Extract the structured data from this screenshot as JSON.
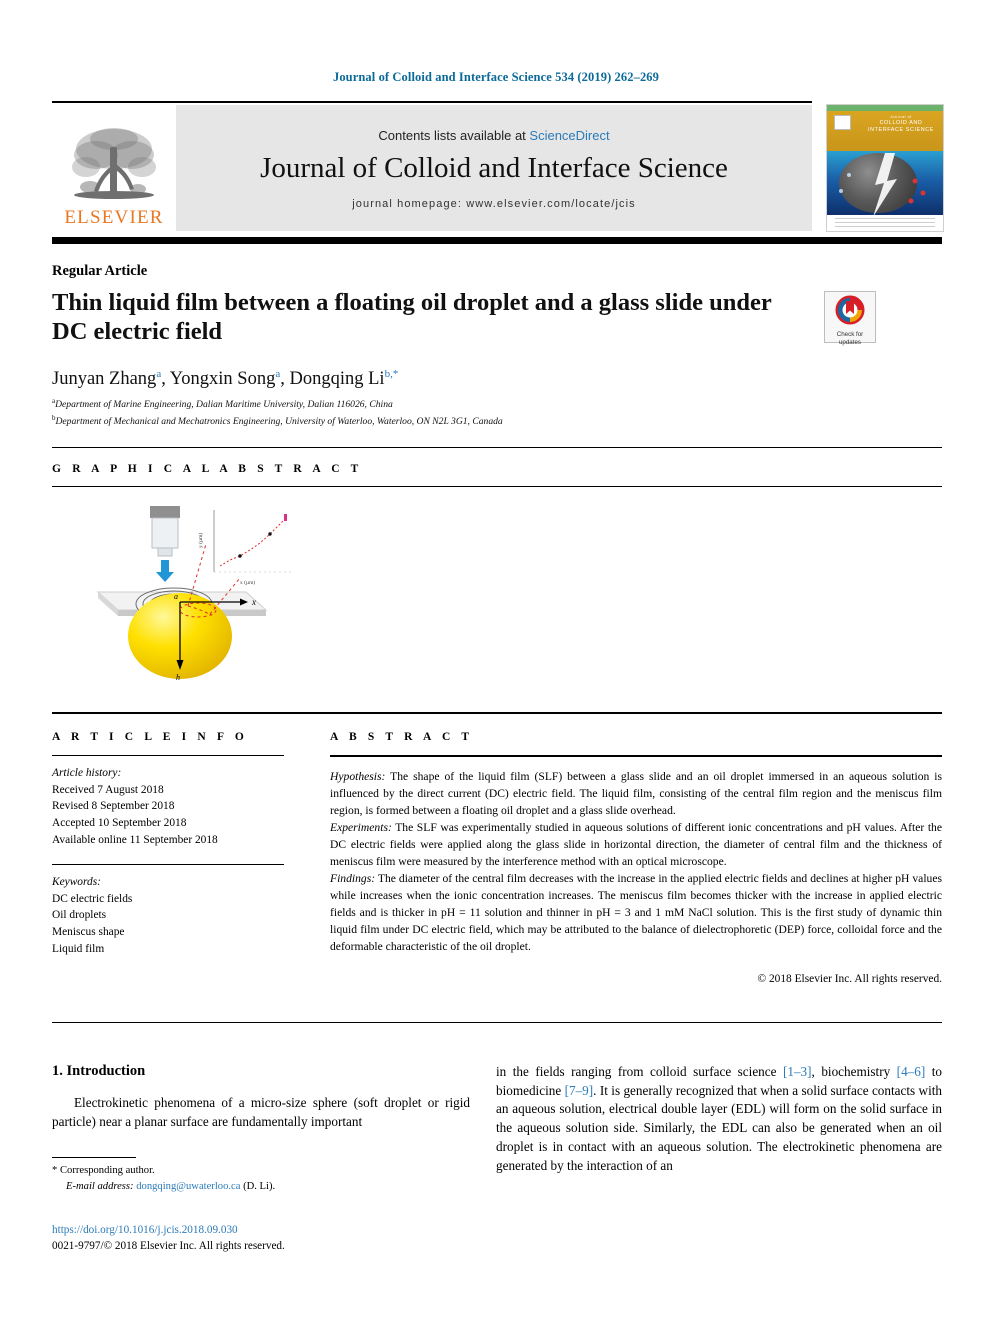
{
  "running_head": "Journal of Colloid and Interface Science 534 (2019) 262–269",
  "masthead": {
    "publisher": "ELSEVIER",
    "contents_prefix": "Contents lists available at ",
    "contents_link": "ScienceDirect",
    "journal_title": "Journal of Colloid and Interface Science",
    "homepage": "journal homepage: www.elsevier.com/locate/jcis",
    "cover_title_small": "Journal of",
    "cover_title": "COLLOID AND INTERFACE SCIENCE"
  },
  "article": {
    "type_label": "Regular Article",
    "title": "Thin liquid film between a floating oil droplet and a glass slide under DC electric field",
    "crossmark_line1": "Check for",
    "crossmark_line2": "updates",
    "authors": [
      {
        "name": "Junyan Zhang",
        "sup": "a",
        "sep": ", "
      },
      {
        "name": "Yongxin Song",
        "sup": "a",
        "sep": ", "
      },
      {
        "name": "Dongqing Li",
        "sup": "b,*",
        "sep": ""
      }
    ],
    "affiliations": [
      {
        "mark": "a",
        "text": "Department of Marine Engineering, Dalian Maritime University, Dalian 116026, China"
      },
      {
        "mark": "b",
        "text": "Department of Mechanical and Mechatronics Engineering, University of Waterloo, Waterloo, ON N2L 3G1, Canada"
      }
    ]
  },
  "graphical_abstract": {
    "heading": "G R A P H I C A L   A B S T R A C T",
    "figure_labels": {
      "axis_x": "x",
      "origin": "a",
      "depth": "h",
      "inset_ylabel": "y (µm)",
      "inset_xlabel": "x (µm)"
    }
  },
  "article_info": {
    "heading": "A R T I C L E   I N F O",
    "history_label": "Article history:",
    "history": [
      "Received 7 August 2018",
      "Revised 8 September 2018",
      "Accepted 10 September 2018",
      "Available online 11 September 2018"
    ],
    "keywords_label": "Keywords:",
    "keywords": [
      "DC electric fields",
      "Oil droplets",
      "Meniscus shape",
      "Liquid film"
    ]
  },
  "abstract": {
    "heading": "A B S T R A C T",
    "sections": [
      {
        "label": "Hypothesis:",
        "text": " The shape of the liquid film (SLF) between a glass slide and an oil droplet immersed in an aqueous solution is influenced by the direct current (DC) electric field. The liquid film, consisting of the central film region and the meniscus film region, is formed between a floating oil droplet and a glass slide overhead."
      },
      {
        "label": "Experiments:",
        "text": " The SLF was experimentally studied in aqueous solutions of different ionic concentrations and pH values. After the DC electric fields were applied along the glass slide in horizontal direction, the diameter of central film and the thickness of meniscus film were measured by the interference method with an optical microscope."
      },
      {
        "label": "Findings:",
        "text": " The diameter of the central film decreases with the increase in the applied electric fields and declines at higher pH values while increases when the ionic concentration increases. The meniscus film becomes thicker with the increase in applied electric fields and is thicker in pH = 11 solution and thinner in pH = 3 and 1 mM NaCl solution. This is the first study of dynamic thin liquid film under DC electric field, which may be attributed to the balance of dielectrophoretic (DEP) force, colloidal force and the deformable characteristic of the oil droplet."
      }
    ],
    "copyright": "© 2018 Elsevier Inc. All rights reserved."
  },
  "body": {
    "section_number_title": "1. Introduction",
    "left_paragraph": "Electrokinetic phenomena of a micro-size sphere (soft droplet or rigid particle) near a planar surface are fundamentally important",
    "right_paragraph_part1": "in the fields ranging from colloid surface science ",
    "right_ref1": "[1–3]",
    "right_paragraph_part2": ", biochemistry ",
    "right_ref2": "[4–6]",
    "right_paragraph_part3": " to biomedicine ",
    "right_ref3": "[7–9]",
    "right_paragraph_part4": ". It is generally recognized that when a solid surface contacts with an aqueous solution, electrical double layer (EDL) will form on the solid surface in the aqueous solution side. Similarly, the EDL can also be generated when an oil droplet is in contact with an aqueous solution. The electrokinetic phenomena are generated by the interaction of an"
  },
  "footer": {
    "corresponding_mark": "*",
    "corresponding_label": "Corresponding author.",
    "email_label": "E-mail address:",
    "email": "dongqing@uwaterloo.ca",
    "email_suffix": " (D. Li).",
    "doi": "https://doi.org/10.1016/j.jcis.2018.09.030",
    "issn_line": "0021-9797/© 2018 Elsevier Inc. All rights reserved."
  },
  "colors": {
    "link": "#2b7bb9",
    "runhead": "#0b6a9a",
    "elsevier_orange": "#E87722"
  }
}
